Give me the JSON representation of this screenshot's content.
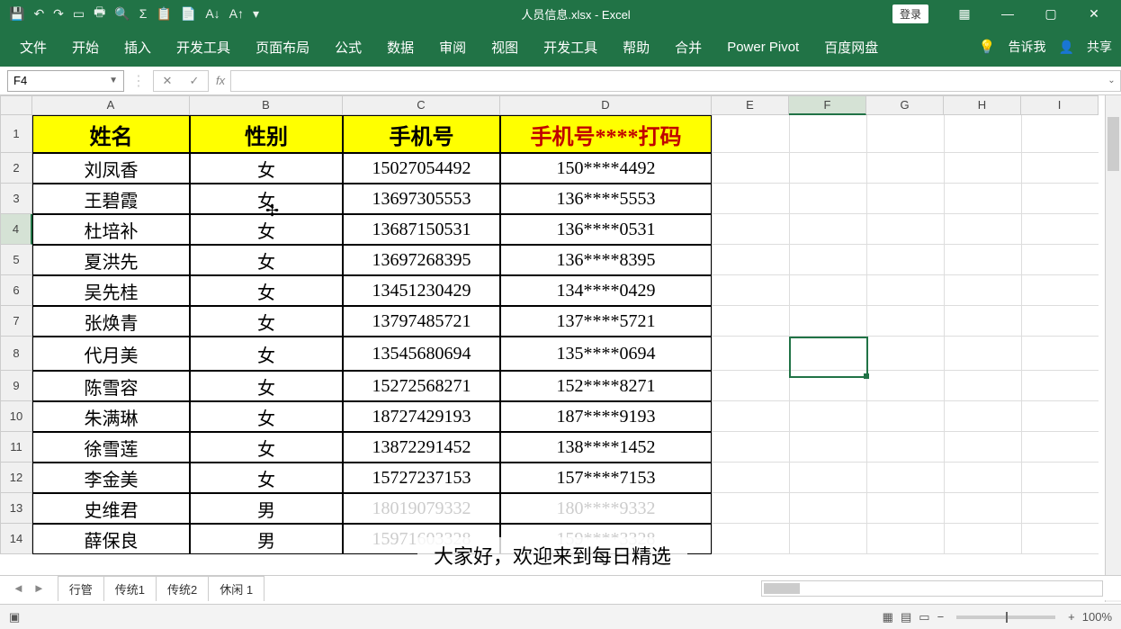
{
  "window": {
    "title": "人员信息.xlsx - Excel",
    "login_label": "登录"
  },
  "ribbon": {
    "tabs": [
      "文件",
      "开始",
      "插入",
      "开发工具",
      "页面布局",
      "公式",
      "数据",
      "审阅",
      "视图",
      "开发工具",
      "帮助",
      "合并",
      "Power Pivot",
      "百度网盘"
    ],
    "tell_me": "告诉我",
    "share": "共享"
  },
  "namebox": {
    "value": "F4"
  },
  "formula": {
    "value": ""
  },
  "columns": [
    "A",
    "B",
    "C",
    "D",
    "E",
    "F",
    "G",
    "H",
    "I"
  ],
  "headers": {
    "A": "姓名",
    "B": "性别",
    "C": "手机号",
    "D": "手机号****打码"
  },
  "rows": [
    {
      "n": 2,
      "A": "刘凤香",
      "B": "女",
      "C": "15027054492",
      "D": "150****4492"
    },
    {
      "n": 3,
      "A": "王碧霞",
      "B": "女",
      "C": "13697305553",
      "D": "136****5553"
    },
    {
      "n": 4,
      "A": "杜培补",
      "B": "女",
      "C": "13687150531",
      "D": "136****0531"
    },
    {
      "n": 5,
      "A": "夏洪先",
      "B": "女",
      "C": "13697268395",
      "D": "136****8395"
    },
    {
      "n": 6,
      "A": "吴先桂",
      "B": "女",
      "C": "13451230429",
      "D": "134****0429"
    },
    {
      "n": 7,
      "A": "张焕青",
      "B": "女",
      "C": "13797485721",
      "D": "137****5721"
    },
    {
      "n": 8,
      "A": "代月美",
      "B": "女",
      "C": "13545680694",
      "D": "135****0694"
    },
    {
      "n": 9,
      "A": "陈雪容",
      "B": "女",
      "C": "15272568271",
      "D": "152****8271"
    },
    {
      "n": 10,
      "A": "朱满琳",
      "B": "女",
      "C": "18727429193",
      "D": "187****9193"
    },
    {
      "n": 11,
      "A": "徐雪莲",
      "B": "女",
      "C": "13872291452",
      "D": "138****1452"
    },
    {
      "n": 12,
      "A": "李金美",
      "B": "女",
      "C": "15727237153",
      "D": "157****7153"
    },
    {
      "n": 13,
      "A": "史维君",
      "B": "男",
      "C": "18019079332",
      "D": "180****9332"
    },
    {
      "n": 14,
      "A": "薛保良",
      "B": "男",
      "C": "15971603328",
      "D": "159****3328"
    }
  ],
  "faded_rows": [
    13,
    14
  ],
  "sheets": [
    "行管",
    "传统1",
    "传统2",
    "休闲 1"
  ],
  "status": {
    "zoom": "100%",
    "plus": "+"
  },
  "subtitle": "大家好，欢迎来到每日精选"
}
